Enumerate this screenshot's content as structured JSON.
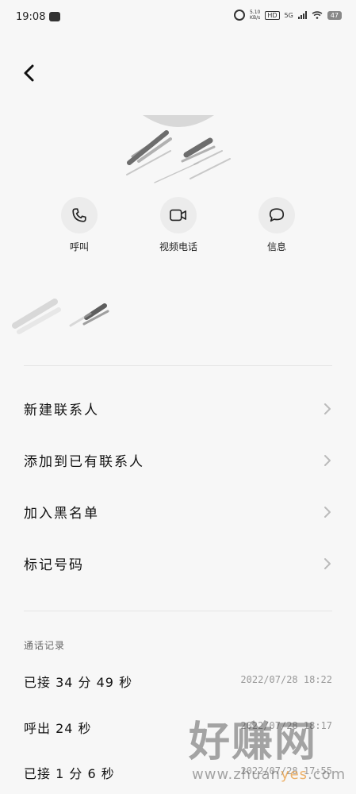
{
  "status_bar": {
    "time": "19:08",
    "net_speed": "5.10\nKB/s",
    "hd": "HD",
    "network": "5G",
    "battery": "47"
  },
  "actions": [
    {
      "label": "呼叫",
      "icon": "phone-icon"
    },
    {
      "label": "视频电话",
      "icon": "video-camera-icon"
    },
    {
      "label": "信息",
      "icon": "message-bubble-icon"
    }
  ],
  "menu": [
    {
      "label": "新建联系人"
    },
    {
      "label": "添加到已有联系人"
    },
    {
      "label": "加入黑名单"
    },
    {
      "label": "标记号码"
    }
  ],
  "call_log": {
    "title": "通话记录",
    "entries": [
      {
        "desc": "已接 34 分 49 秒",
        "time": "2022/07/28 18:22"
      },
      {
        "desc": "呼出 24 秒",
        "time": "2022/07/28 18:17"
      },
      {
        "desc": "已接 1 分 6 秒",
        "time": "2022/07/28 17:55"
      }
    ]
  },
  "watermark": {
    "title": "好赚网",
    "url_prefix": "www.zhuan",
    "url_accent": "yes",
    "url_suffix": ".com"
  },
  "colors": {
    "background": "#f7f7f7",
    "action_circle": "#ececec",
    "divider": "#e6e6e6",
    "secondary_text": "#999999"
  }
}
